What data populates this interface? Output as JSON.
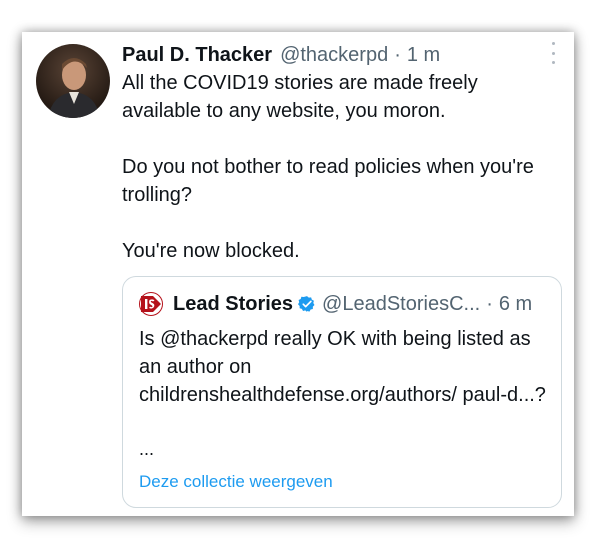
{
  "tweet": {
    "author_name": "Paul D. Thacker",
    "author_handle": "@thackerpd",
    "separator": "·",
    "time": "1 m",
    "paragraphs": [
      "All the COVID19 stories are made freely available to any website, you moron.",
      "Do you not bother to read policies when you're trolling?",
      "You're now blocked."
    ]
  },
  "quote": {
    "author_name": "Lead Stories",
    "author_handle": "@LeadStoriesC...",
    "separator": "·",
    "time": "6 m",
    "text": "Is @thackerpd really OK with being listed as an author on childrenshealthdefense.org/authors/ paul-d...?",
    "ellipsis": "...",
    "link_label": "Deze collectie weergeven"
  },
  "icons": {
    "more": "more-vertical-icon",
    "verified": "verified-badge-icon",
    "logo": "lead-stories-logo-icon"
  },
  "colors": {
    "text": "#0f1419",
    "muted": "#536471",
    "link": "#1d9bf0",
    "verified": "#1d9bf0",
    "logo": "#b5121b"
  }
}
